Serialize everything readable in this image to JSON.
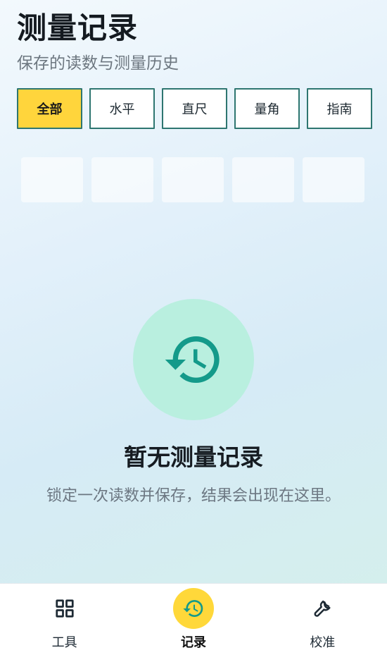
{
  "header": {
    "title": "测量记录",
    "subtitle": "保存的读数与测量历史"
  },
  "filters": [
    {
      "label": "全部",
      "active": true
    },
    {
      "label": "水平",
      "active": false
    },
    {
      "label": "直尺",
      "active": false
    },
    {
      "label": "量角",
      "active": false
    },
    {
      "label": "指南",
      "active": false
    }
  ],
  "empty_state": {
    "icon": "history-icon",
    "title": "暂无测量记录",
    "description": "锁定一次读数并保存，结果会出现在这里。"
  },
  "bottom_nav": {
    "items": [
      {
        "label": "工具",
        "icon": "grid-icon",
        "active": false
      },
      {
        "label": "记录",
        "icon": "history-icon",
        "active": true
      },
      {
        "label": "校准",
        "icon": "wrench-icon",
        "active": false
      }
    ]
  },
  "colors": {
    "accent": "#ffd53c",
    "teal": "#149a8a",
    "chip_border": "#2e7670",
    "empty_circle": "#b9efdf"
  }
}
